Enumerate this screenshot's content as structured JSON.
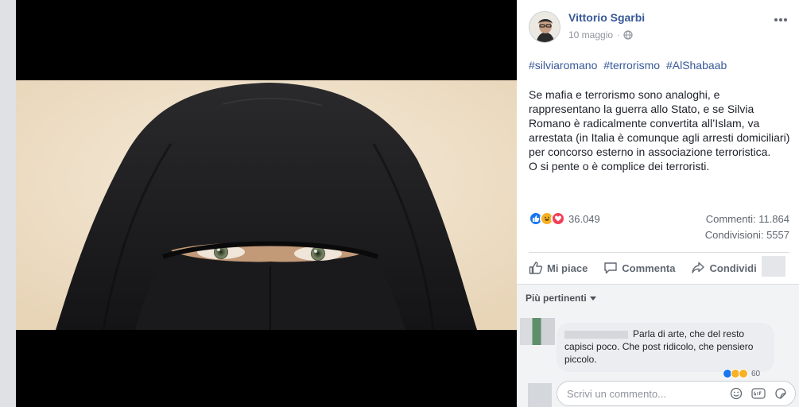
{
  "post": {
    "author": "Vittorio Sgarbi",
    "date": "10 maggio",
    "privacy_icon": "globe-icon",
    "hashtags": [
      "#silviaromano",
      "#terrorismo",
      "#AlShabaab"
    ],
    "body": [
      "Se mafia e terrorismo sono analoghi, e rappresentano la guerra allo Stato, e se Silvia Romano è radicalmente convertita all’Islam, va arrestata (in Italia è comunque agli arresti domiciliari) per concorso esterno in associazione terroristica.",
      "O si pente o è complice dei terroristi."
    ]
  },
  "stats": {
    "reactions_count": "36.049",
    "reaction_types": [
      "like",
      "haha",
      "love"
    ],
    "comments": "Commenti: 11.864",
    "shares": "Condivisioni: 5557"
  },
  "actions": {
    "like": "Mi piace",
    "comment": "Commenta",
    "share": "Condividi"
  },
  "comments": {
    "sort_label": "Più pertinenti",
    "first_comment_text": "Parla di arte, che del resto capisci poco. Che post ridicolo, che pensiero piccolo.",
    "first_comment_reactions": "60",
    "composer_placeholder": "Scrivi un commento...",
    "composer_icons": [
      "emoji-icon",
      "gif-icon",
      "sticker-icon"
    ]
  },
  "colors": {
    "link": "#385898",
    "like": "#1877f2",
    "haha": "#f7b125",
    "love": "#f33e58"
  }
}
